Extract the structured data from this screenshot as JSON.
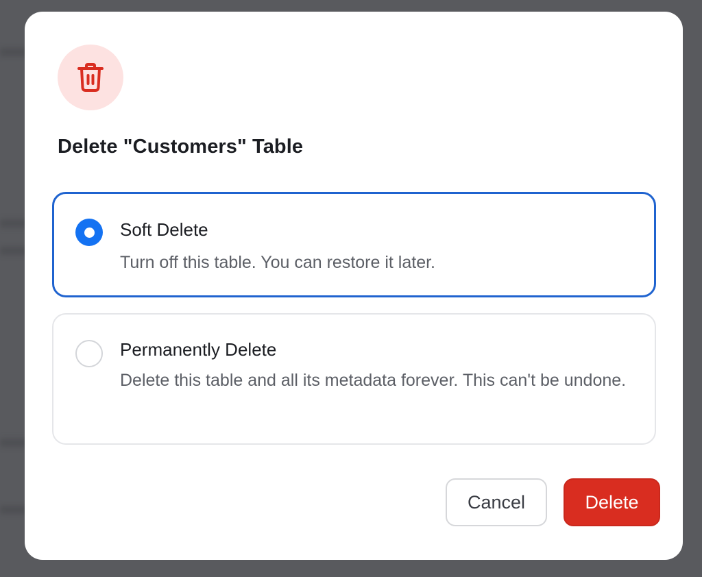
{
  "dialog": {
    "title": "Delete \"Customers\" Table",
    "icon": "trash-icon",
    "accent_color": "#d92d20",
    "selected_color": "#1472f2"
  },
  "options": [
    {
      "label": "Soft Delete",
      "description": "Turn off this table. You can restore it later.",
      "selected": true
    },
    {
      "label": "Permanently Delete",
      "description": "Delete this table and all its metadata forever. This can't be undone.",
      "selected": false
    }
  ],
  "buttons": {
    "cancel_label": "Cancel",
    "delete_label": "Delete"
  }
}
